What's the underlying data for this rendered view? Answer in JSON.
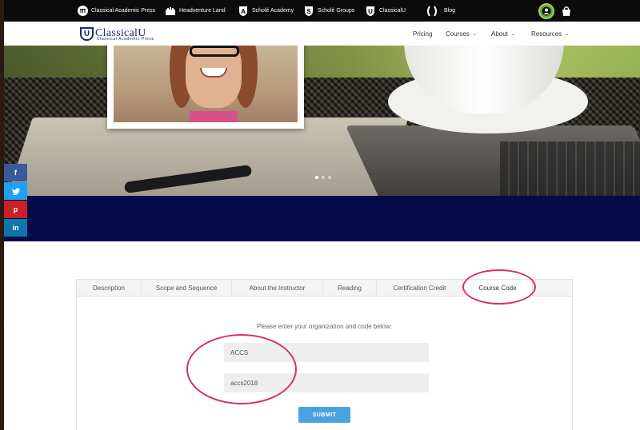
{
  "topbar": {
    "links": [
      {
        "label": "Classical Academic Press",
        "icon": "columns-icon"
      },
      {
        "label": "Headventure Land",
        "icon": "castle-icon"
      },
      {
        "label": "Scholé Academy",
        "icon": "shield-a-icon"
      },
      {
        "label": "Scholé Groups",
        "icon": "shield-s-icon"
      },
      {
        "label": "ClassicalU",
        "icon": "shield-u-icon"
      },
      {
        "label": "Blog",
        "icon": "laurel-icon"
      }
    ]
  },
  "header": {
    "logo_name": "ClassicalU",
    "logo_sub": "Classical Academic Press",
    "nav": [
      {
        "label": "Pricing",
        "dropdown": false
      },
      {
        "label": "Courses",
        "dropdown": true
      },
      {
        "label": "About",
        "dropdown": true
      },
      {
        "label": "Resources",
        "dropdown": true
      }
    ]
  },
  "social": [
    {
      "label": "f",
      "color": "#3b5998",
      "icon": "facebook-icon"
    },
    {
      "label": "t",
      "color": "#1da1f2",
      "icon": "twitter-icon"
    },
    {
      "label": "p",
      "color": "#cb2027",
      "icon": "pinterest-icon"
    },
    {
      "label": "in",
      "color": "#0e76a8",
      "icon": "linkedin-icon"
    }
  ],
  "tabs": [
    {
      "label": "Description",
      "active": false
    },
    {
      "label": "Scope and Sequence",
      "active": false
    },
    {
      "label": "About the Instructor",
      "active": false
    },
    {
      "label": "Reading",
      "active": false
    },
    {
      "label": "Certification Credit",
      "active": false
    },
    {
      "label": "Course Code",
      "active": true
    }
  ],
  "course_code": {
    "prompt": "Please enter your organization and code below:",
    "organization_value": "ACCS",
    "code_value": "accs2018",
    "submit_label": "SUBMIT"
  },
  "colors": {
    "navy": "#040a4a",
    "annotation": "#d6306e",
    "submit": "#4aa3e0"
  }
}
